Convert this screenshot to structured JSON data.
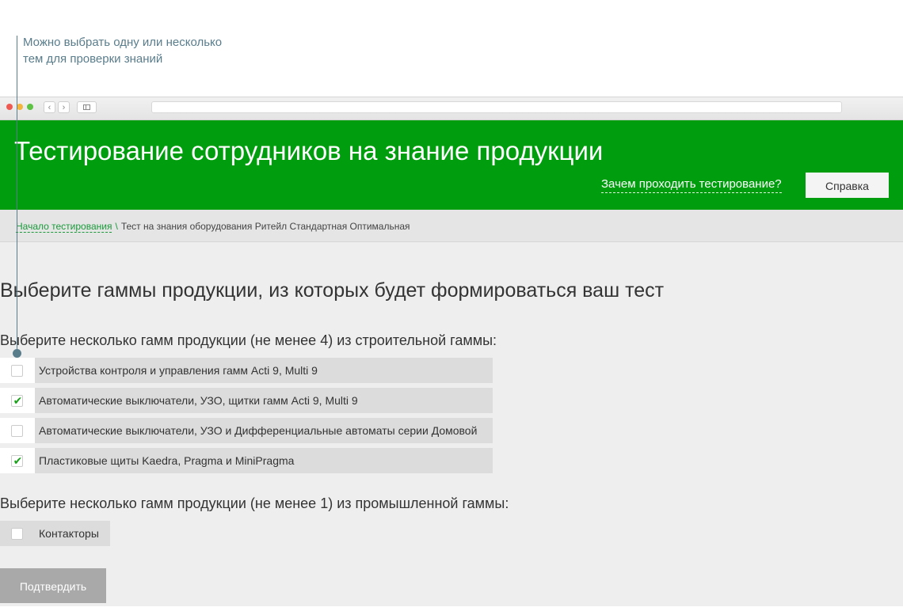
{
  "annotation": {
    "line1": "Можно выбрать одну или несколько",
    "line2": "тем для проверки знаний"
  },
  "header": {
    "title": "Тестирование сотрудников на знание продукции",
    "why_link": "Зачем проходить тестирование?",
    "help_button": "Справка",
    "color": "#009e0f"
  },
  "breadcrumb": {
    "home": "Начало тестирования",
    "separator": "\\",
    "current": "Тест на знания оборудования Ритейл Стандартная Оптимальная"
  },
  "main": {
    "title": "Выберите гаммы продукции, из которых будет формироваться ваш тест",
    "sections": [
      {
        "label": "Выберите несколько гамм продукции (не менее 4) из строительной гаммы:",
        "options": [
          {
            "label": "Устройства контроля и управления гамм Acti 9, Multi 9",
            "checked": false
          },
          {
            "label": "Автоматические выключатели, УЗО, щитки гамм Acti 9, Multi 9",
            "checked": true
          },
          {
            "label": "Автоматические выключатели, УЗО и Дифференциальные автоматы серии Домовой",
            "checked": false
          },
          {
            "label": "Пластиковые щиты Kaedra, Pragma и MiniPragma",
            "checked": true
          }
        ]
      },
      {
        "label": "Выберите несколько гамм продукции (не менее 1) из промышленной гаммы:",
        "options": [
          {
            "label": "Контакторы",
            "checked": false
          }
        ]
      }
    ],
    "submit_button": "Подтвердить"
  },
  "icons": {
    "checked_mark": "✔",
    "back": "‹",
    "forward": "›"
  }
}
